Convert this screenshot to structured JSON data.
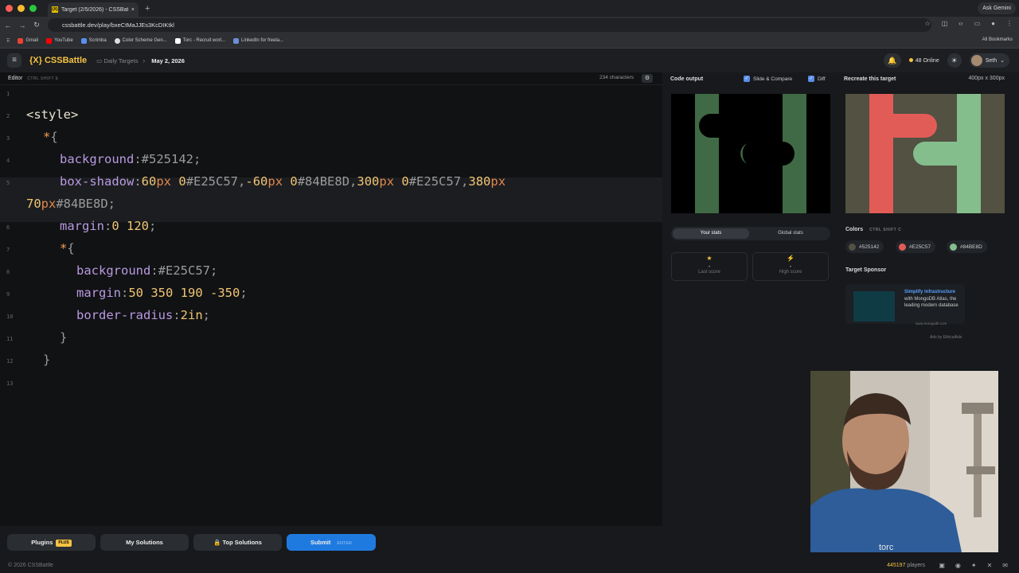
{
  "browser": {
    "tab_title": "Target (2/5/2026) - CSSBatt",
    "tab_favicon": "{X}",
    "new_tab": "+",
    "gemini": "Ask Gemini",
    "url": "cssbattle.dev/play/bxeCtMaJJEs3KcDIKtkl",
    "bookmarks": [
      "Gmail",
      "YouTube",
      "Scrimba",
      "Color Scheme Gen...",
      "Torc - Recruit worl...",
      "LinkedIn for freela..."
    ],
    "all_bookmarks": "All Bookmarks"
  },
  "header": {
    "logo": "{X} CSSBattle",
    "crumb1": "Daily Targets",
    "crumb2": "May 2, 2026",
    "online": "48 Online",
    "user": "Seth"
  },
  "editor": {
    "title": "Editor",
    "shortcut": "CTRL  SHIFT  E",
    "chars": "234 characters"
  },
  "code": {
    "l2": "<style>",
    "l3a": "*",
    "l3b": "{",
    "l4a": "background",
    "l4b": ":",
    "l4c": "#525142",
    "l4d": ";",
    "l5a": "box-shadow",
    "l5b": ":",
    "l5c": "60",
    "l5d": "px",
    "l5e": " 0",
    "l5f": "#E25C57",
    "l5g": ",",
    "l5h": "-60",
    "l5i": "px",
    "l5j": " 0",
    "l5k": "#84BE8D",
    "l5l": ",",
    "l5m": "300",
    "l5n": "px",
    "l5o": " 0",
    "l5p": "#E25C57",
    "l5q": ",",
    "l5r": "380",
    "l5s": "px",
    "l5t": "70",
    "l5u": "px",
    "l5v": "#84BE8D",
    "l5w": ";",
    "l6a": "margin",
    "l6b": ":",
    "l6c": "0 120",
    "l6d": ";",
    "l7a": "*",
    "l7b": "{",
    "l8a": "background",
    "l8b": ":",
    "l8c": "#E25C57",
    "l8d": ";",
    "l9a": "margin",
    "l9b": ":",
    "l9c": "50 350 190 -350",
    "l9d": ";",
    "l10a": "border-radius",
    "l10b": ":",
    "l10c": "2in",
    "l10d": ";",
    "l11": "}",
    "l12": "}",
    "line_numbers": [
      "1",
      "2",
      "3",
      "4",
      "5",
      "6",
      "7",
      "8",
      "9",
      "10",
      "11",
      "12",
      "13"
    ]
  },
  "bottom": {
    "plugins": "Plugins",
    "plus": "PLUS",
    "my_solutions": "My Solutions",
    "top_solutions": "Top Solutions",
    "submit": "Submit",
    "enter": "ENTER"
  },
  "output": {
    "title": "Code output",
    "slide": "Slide & Compare",
    "diff": "Diff",
    "tab_your": "Your stats",
    "tab_global": "Global stats",
    "last_score_label": "Last score",
    "high_score_label": "High score",
    "dash": "-"
  },
  "target": {
    "title": "Recreate this target",
    "size": "400px x 300px",
    "colors_label": "Colors",
    "colors_shortcut": "CTRL  SHIFT  C",
    "colors": [
      {
        "hex": "#525142",
        "label": "#525142"
      },
      {
        "hex": "#E25C57",
        "label": "#E25C57"
      },
      {
        "hex": "#84BE8D",
        "label": "#84BE8D"
      }
    ],
    "sponsor_label": "Target Sponsor",
    "ad_title": "Simplify infrastructure",
    "ad_body": "with MongoDB Atlas, the leading modern database",
    "ad_url": "www.mongodb.com",
    "ads_by": "Ads by EthicalAds"
  },
  "footer": {
    "copyright": "© 2026 CSSBattle",
    "players_count": "445197",
    "players_label": "players"
  }
}
